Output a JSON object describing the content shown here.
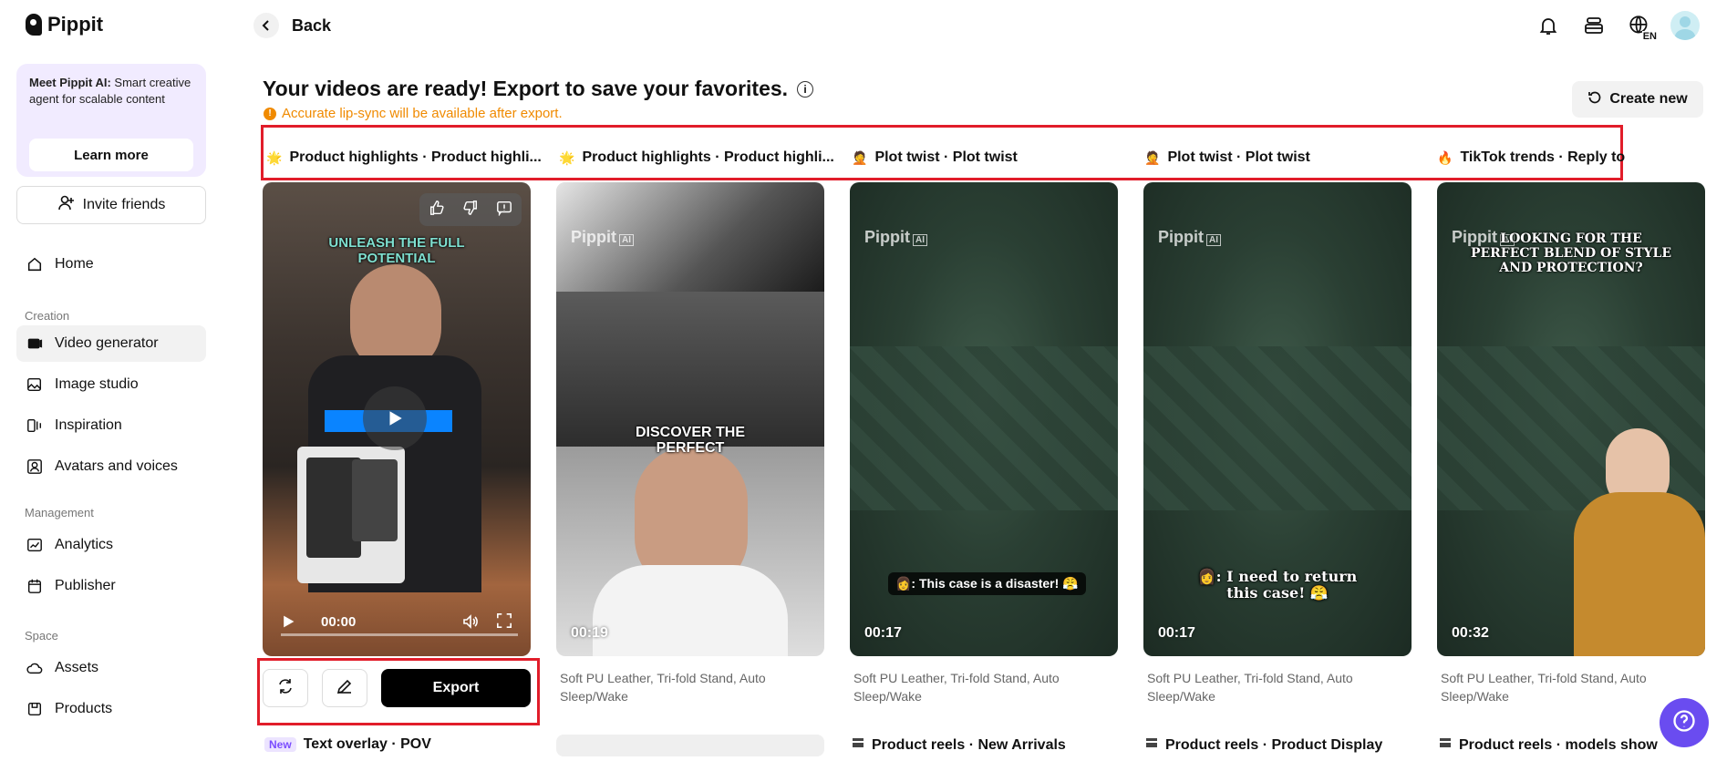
{
  "sidebar": {
    "logo": "Pippit",
    "promo": {
      "title": "Meet Pippit AI:",
      "text": "Smart creative agent for scalable content",
      "button": "Learn more"
    },
    "invite": "Invite friends",
    "home": "Home",
    "sections": {
      "creation": "Creation",
      "management": "Management",
      "space": "Space"
    },
    "items": {
      "video_generator": "Video generator",
      "image_studio": "Image studio",
      "inspiration": "Inspiration",
      "avatars": "Avatars and voices",
      "analytics": "Analytics",
      "publisher": "Publisher",
      "assets": "Assets",
      "products": "Products"
    }
  },
  "topbar": {
    "back": "Back",
    "lang": "EN"
  },
  "main": {
    "heading": "Your videos are ready! Export to save your favorites.",
    "warning": "Accurate lip-sync will be available after export.",
    "create_new": "Create new",
    "tags": [
      {
        "emoji": "🌟",
        "text": "Product highlights · Product highli..."
      },
      {
        "emoji": "🌟",
        "text": "Product highlights · Product highli..."
      },
      {
        "emoji": "🤦",
        "text": "Plot twist · Plot twist"
      },
      {
        "emoji": "🤦",
        "text": "Plot twist · Plot twist"
      },
      {
        "emoji": "🔥",
        "text": "TikTok trends · Reply to"
      }
    ],
    "cards": [
      {
        "caption": "UNLEASH THE FULL POTENTIAL",
        "time": "00:00"
      },
      {
        "watermark": "Pippit",
        "caption": "DISCOVER THE PERFECT",
        "duration": "00:19"
      },
      {
        "watermark": "Pippit",
        "subtitle": "👩: This case is a disaster! 😤",
        "duration": "00:17"
      },
      {
        "watermark": "Pippit",
        "subtitle": "👩: I need to return this case! 😤",
        "duration": "00:17"
      },
      {
        "watermark": "Pippit",
        "caption": "LOOKING FOR THE PERFECT BLEND OF STYLE AND PROTECTION?",
        "duration": "00:32"
      }
    ],
    "description": "Soft PU Leather, Tri-fold Stand, Auto Sleep/Wake",
    "export": "Export",
    "bottom_tags": [
      {
        "badge": "New",
        "text": "Text overlay · POV"
      },
      {
        "text": "Product reels · New Arrivals"
      },
      {
        "text": "Product reels · Product Display"
      },
      {
        "text": "Product reels · models show"
      }
    ]
  },
  "colors": {
    "accent": "#6a4cf0",
    "warning": "#f08a00",
    "highlight": "#e11d2a"
  }
}
